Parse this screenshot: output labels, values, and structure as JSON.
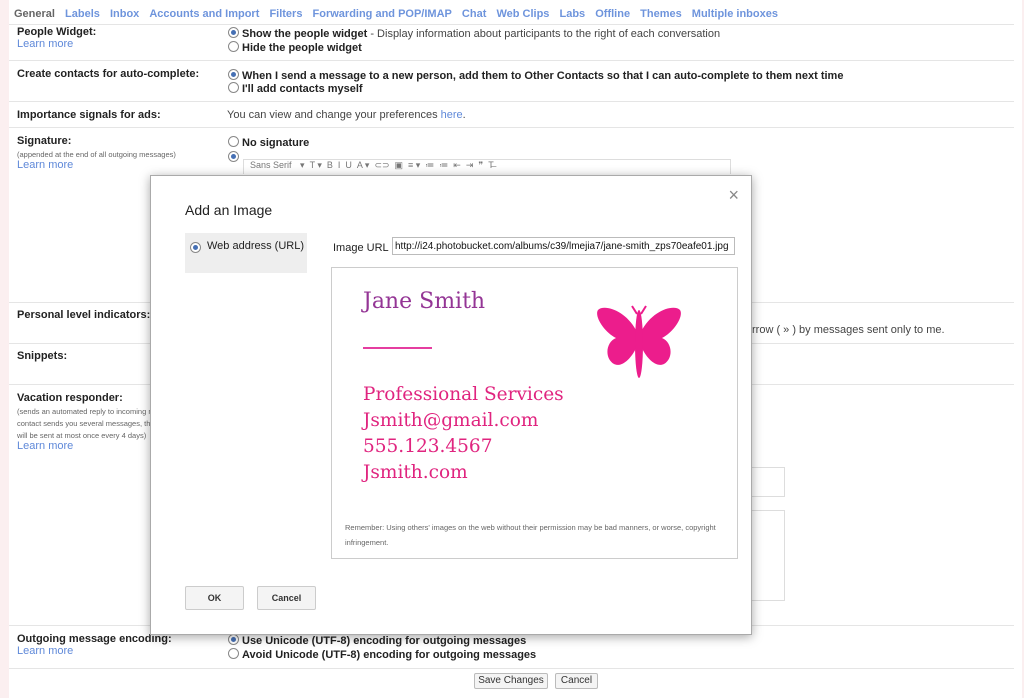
{
  "tabs": [
    "General",
    "Labels",
    "Inbox",
    "Accounts and Import",
    "Filters",
    "Forwarding and POP/IMAP",
    "Chat",
    "Web Clips",
    "Labs",
    "Offline",
    "Themes",
    "Multiple inboxes"
  ],
  "learn_more": "Learn more",
  "people_widget": {
    "label": "People Widget:",
    "show_bold": "Show the people widget",
    "show_rest": " - Display information about participants to the right of each conversation",
    "hide": "Hide the people widget"
  },
  "contacts": {
    "label": "Create contacts for auto-complete:",
    "opt1": "When I send a message to a new person, add them to Other Contacts so that I can auto-complete to them next time",
    "opt2": "I'll add contacts myself"
  },
  "importance": {
    "label": "Importance signals for ads:",
    "text": "You can view and change your preferences ",
    "link": "here",
    "end": "."
  },
  "signature": {
    "label": "Signature:",
    "sub": "(appended at the end of all outgoing messages)",
    "no_sig": "No signature",
    "font": "Sans Serif"
  },
  "personal": {
    "label": "Personal level indicators:",
    "right_text": "rrow ( » ) by messages sent only to me."
  },
  "snippets": {
    "label": "Snippets:"
  },
  "vacation": {
    "label": "Vacation responder:",
    "sub1": "(sends an automated reply to incoming m",
    "sub2": "contact sends you several messages, thi",
    "sub3": "will be sent at most once every 4 days)"
  },
  "encoding": {
    "label": "Outgoing message encoding:",
    "opt1": "Use Unicode (UTF-8) encoding for outgoing messages",
    "opt2": "Avoid Unicode (UTF-8) encoding for outgoing messages"
  },
  "bottom": {
    "save": "Save Changes",
    "cancel": "Cancel"
  },
  "dialog": {
    "title": "Add an Image",
    "close": "×",
    "source_label": "Web address (URL)",
    "url_label": "Image URL",
    "url_value": "http://i24.photobucket.com/albums/c39/lmejia7/jane-smith_zps70eafe01.jpg",
    "card": {
      "name": "Jane Smith",
      "line1": "Professional Services",
      "line2": "Jsmith@gmail.com",
      "line3": "555.123.4567",
      "line4": "Jsmith.com"
    },
    "disclaimer": "Remember: Using others' images on the web without their permission may be bad manners, or worse, copyright infringement.",
    "ok": "OK",
    "cancel": "Cancel"
  },
  "colors": {
    "link": "#5f89d9",
    "card_name": "#943595",
    "card_pink": "#e0247f",
    "butterfly": "#ec1d8c"
  }
}
